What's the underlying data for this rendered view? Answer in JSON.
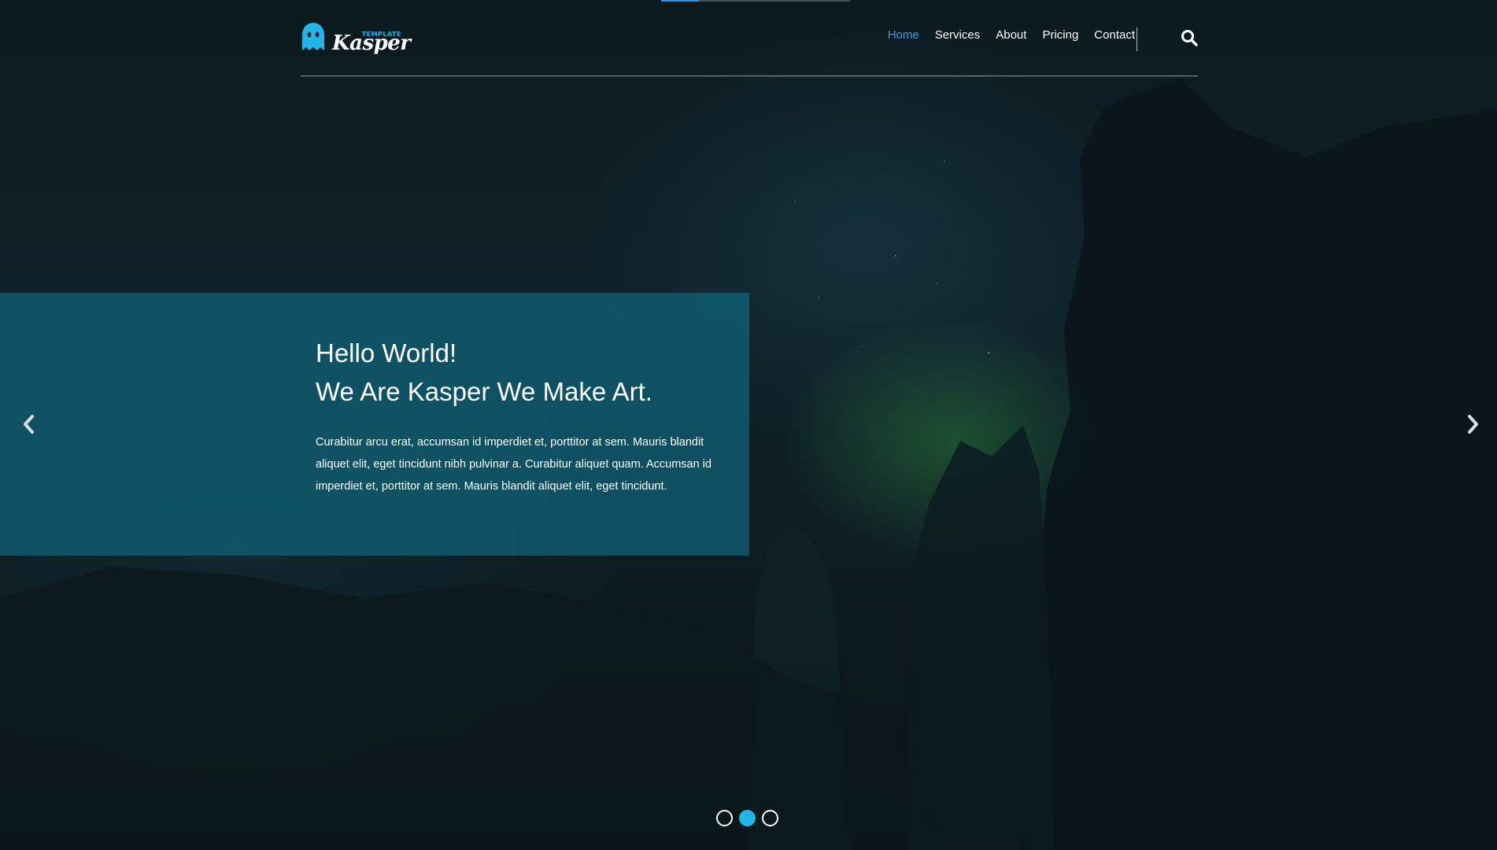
{
  "brand": {
    "name": "Kasper",
    "tag": "TEMPLATE",
    "accent_color": "#23b5e8"
  },
  "nav": {
    "items": [
      {
        "label": "Home",
        "active": true
      },
      {
        "label": "Services",
        "active": false
      },
      {
        "label": "About",
        "active": false
      },
      {
        "label": "Pricing",
        "active": false
      },
      {
        "label": "Contact",
        "active": false
      }
    ],
    "active_color": "#3d9be9",
    "search_icon": "search-icon"
  },
  "hero": {
    "title_line1": "Hello World!",
    "title_line2": "We Are Kasper We Make Art.",
    "body": "Curabitur arcu erat, accumsan id imperdiet et, porttitor at sem. Mauris blandit aliquet elit, eget tincidunt nibh pulvinar a. Curabitur aliquet quam. Accumsan id imperdiet et, porttitor at sem. Mauris blandit aliquet elit, eget tincidunt.",
    "panel_color": "#0f6880"
  },
  "slider": {
    "prev_icon": "chevron-left-icon",
    "next_icon": "chevron-right-icon",
    "slide_count": 3,
    "active_slide": 2
  }
}
